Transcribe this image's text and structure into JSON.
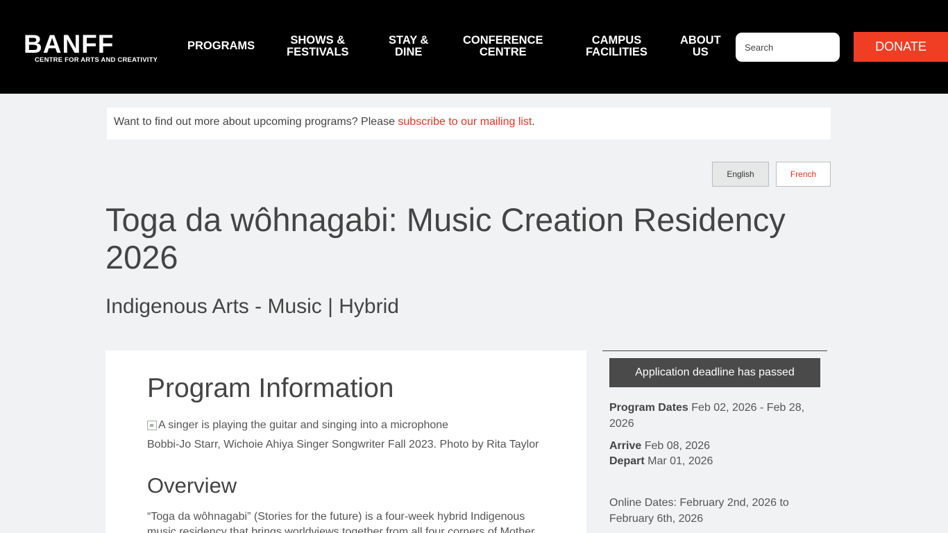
{
  "header": {
    "logo_word": "BANFF",
    "logo_sub": "CENTRE FOR ARTS AND CREATIVITY",
    "nav": [
      {
        "line1": "PROGRAMS",
        "line2": ""
      },
      {
        "line1": "SHOWS &",
        "line2": "FESTIVALS"
      },
      {
        "line1": "STAY &",
        "line2": "DINE"
      },
      {
        "line1": "CONFERENCE",
        "line2": "CENTRE"
      },
      {
        "line1": "CAMPUS",
        "line2": "FACILITIES"
      },
      {
        "line1": "ABOUT",
        "line2": "US"
      }
    ],
    "search_placeholder": "Search",
    "donate_label": "DONATE"
  },
  "notice": {
    "text": "Want to find out more about upcoming programs? Please ",
    "link": "subscribe to our mailing list",
    "end": "."
  },
  "languages": {
    "english": "English",
    "french": "French"
  },
  "page": {
    "title": "Toga da wôhnagabi: Music Creation Residency 2026",
    "subtitle": "Indigenous Arts - Music | Hybrid"
  },
  "main": {
    "heading": "Program Information",
    "image_alt": "A singer is playing the guitar and singing into a microphone",
    "caption": "Bobbi-Jo Starr, Wichoie Ahiya Singer Songwriter Fall 2023. Photo by Rita Taylor",
    "overview_heading": "Overview",
    "overview_text": "“Toga da wôhnagabi” (Stories for the future) is a four-week hybrid Indigenous music residency that brings worldviews together from all four corners of Mother"
  },
  "sidebar": {
    "deadline": "Application deadline has passed",
    "program_dates_label": "Program Dates",
    "program_dates_value": " Feb 02, 2026 - Feb 28, 2026",
    "arrive_label": "Arrive",
    "arrive_value": " Feb 08, 2026",
    "depart_label": "Depart",
    "depart_value": " Mar 01, 2026",
    "online_dates": "Online Dates: February 2nd, 2026 to February 6th, 2026"
  },
  "colors": {
    "header_bg": "#000000",
    "accent": "#f03e25",
    "link": "#e5341d",
    "page_bg": "#f1f2f3",
    "deadline_bg": "#4a4a4a"
  }
}
